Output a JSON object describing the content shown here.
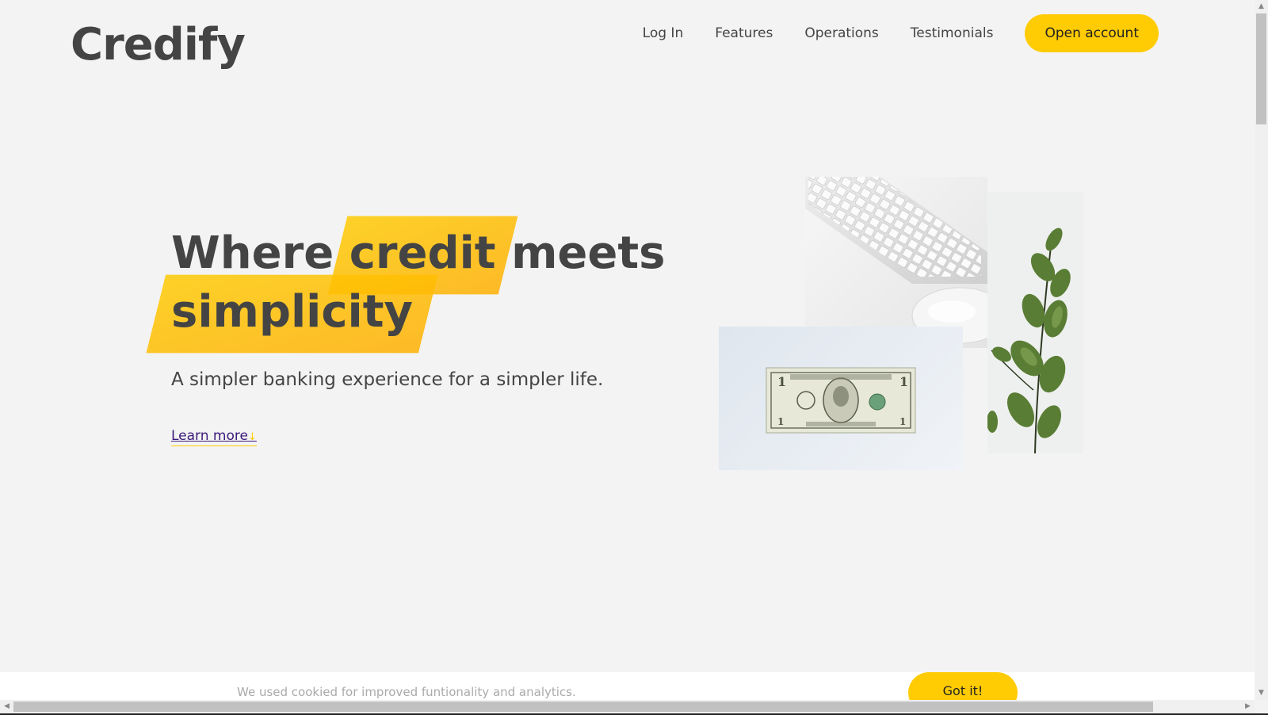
{
  "brand": {
    "logo": "Credify"
  },
  "nav": {
    "links": [
      "Log In",
      "Features",
      "Operations",
      "Testimonials"
    ],
    "cta": "Open account"
  },
  "hero": {
    "title_word_1": "Where",
    "title_highlight_1": "credit",
    "title_word_2": "meets",
    "title_highlight_2": "simplicity",
    "subtitle": "A simpler banking experience for a simpler life.",
    "learn_more": "Learn more",
    "learn_more_arrow": "↓",
    "images": [
      "keyboard-and-mouse-image",
      "dollar-bill-image",
      "eucalyptus-plant-image"
    ]
  },
  "cookie": {
    "message": "We used cookied for improved funtionality and analytics.",
    "button": "Got it!"
  },
  "colors": {
    "accent": "#ffcb03",
    "text": "#444444",
    "background": "#f3f3f3",
    "link": "#3b1a7a"
  }
}
